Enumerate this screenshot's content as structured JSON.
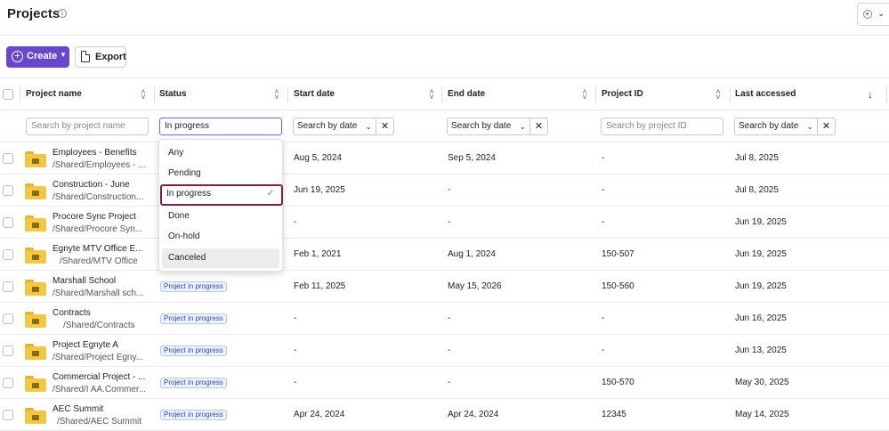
{
  "page": {
    "title": "Projects",
    "info_icon": "info-icon",
    "view_icon": "eye-icon"
  },
  "toolbar": {
    "create_label": "Create",
    "export_label": "Export"
  },
  "columns": {
    "name": "Project name",
    "status": "Status",
    "start": "Start date",
    "end": "End date",
    "id": "Project ID",
    "accessed": "Last accessed"
  },
  "filters": {
    "name_placeholder": "Search by project name",
    "status_value": "In progress",
    "start_value": "Search by date",
    "end_value": "Search by date",
    "id_placeholder": "Search by project ID",
    "accessed_value": "Search by date",
    "clear_symbol": "✕"
  },
  "status_dropdown": {
    "options": [
      "Any",
      "Pending",
      "In progress",
      "Done",
      "On-hold",
      "Canceled"
    ],
    "selected": "In progress",
    "hovered": "Canceled"
  },
  "rows": [
    {
      "name": "Employees - Benefits",
      "path": "/Shared/Employees - ...",
      "status": "",
      "start": "Aug 5, 2024",
      "end": "Sep 5, 2024",
      "id": "-",
      "accessed": "Jul 8, 2025"
    },
    {
      "name": "Construction - June",
      "path": "/Shared/Construction...",
      "status": "",
      "start": "Jun 19, 2025",
      "end": "-",
      "id": "-",
      "accessed": "Jul 8, 2025"
    },
    {
      "name": "Procore Sync Project",
      "path": "/Shared/Procore Syn...",
      "status": "",
      "start": "-",
      "end": "-",
      "id": "-",
      "accessed": "Jun 19, 2025"
    },
    {
      "name": "Egnyte MTV Office E...",
      "path": "/Shared/MTV Office",
      "status": "",
      "start": "Feb 1, 2021",
      "end": "Aug 1, 2024",
      "id": "150-507",
      "accessed": "Jun 19, 2025"
    },
    {
      "name": "Marshall School",
      "path": "/Shared/Marshall sch...",
      "status": "Project in progress",
      "start": "Feb 11, 2025",
      "end": "May 15, 2026",
      "id": "150-560",
      "accessed": "Jun 19, 2025"
    },
    {
      "name": "Contracts",
      "path": "/Shared/Contracts",
      "status": "Project in progress",
      "start": "-",
      "end": "-",
      "id": "-",
      "accessed": "Jun 16, 2025"
    },
    {
      "name": "Project Egnyte A",
      "path": "/Shared/Project Egny...",
      "status": "Project in progress",
      "start": "-",
      "end": "-",
      "id": "-",
      "accessed": "Jun 13, 2025"
    },
    {
      "name": "Commercial Project - ...",
      "path": "/Shared/I AA.Commer...",
      "status": "Project in progress",
      "start": "-",
      "end": "-",
      "id": "150-570",
      "accessed": "May 30, 2025"
    },
    {
      "name": "AEC Summit",
      "path": "/Shared/AEC Summit",
      "status": "Project in progress",
      "start": "Apr 24, 2024",
      "end": "Apr 24, 2024",
      "id": "12345",
      "accessed": "May 14, 2025"
    }
  ],
  "colors": {
    "accent": "#6a46c8",
    "selected_outline": "#7a2144",
    "folder": "#f2c744",
    "badge_text": "#2f4d9a"
  }
}
